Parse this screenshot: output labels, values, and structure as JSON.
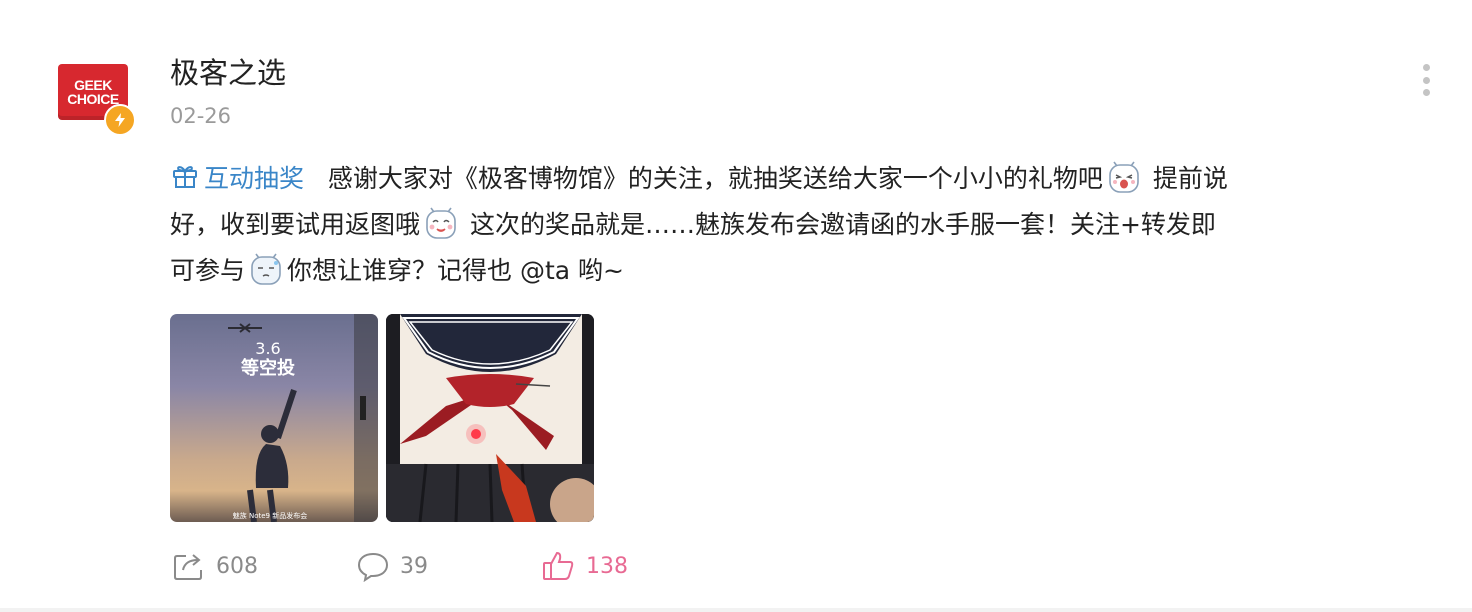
{
  "user": {
    "name": "极客之选",
    "avatar_text_line1": "GEEK",
    "avatar_text_line2": "CHOICE",
    "verified": true,
    "date": "02-26"
  },
  "post": {
    "lottery_tag": "互动抽奖",
    "segment1": "感谢大家对《极客博物馆》的关注，就抽奖送给大家一个小小的礼物吧",
    "segment2": "提前说好，收到要试用返图哦",
    "segment3": "这次的奖品就是……魅族发布会邀请函的水手服一套！关注+转发即可参与",
    "segment4": "你想让谁穿？记得也 @ta 哟~"
  },
  "images": [
    {
      "overlay_line1": "3.6",
      "overlay_line2": "等空投",
      "caption": "魅族 Note9 新品发布会"
    },
    {
      "overlay_line1": "",
      "overlay_line2": "",
      "caption": ""
    }
  ],
  "actions": {
    "repost_count": "608",
    "comment_count": "39",
    "like_count": "138"
  },
  "colors": {
    "link_blue": "#3a86c8",
    "like_pink": "#e86a93",
    "brand_red": "#d7282f",
    "badge_orange": "#f5a623"
  }
}
